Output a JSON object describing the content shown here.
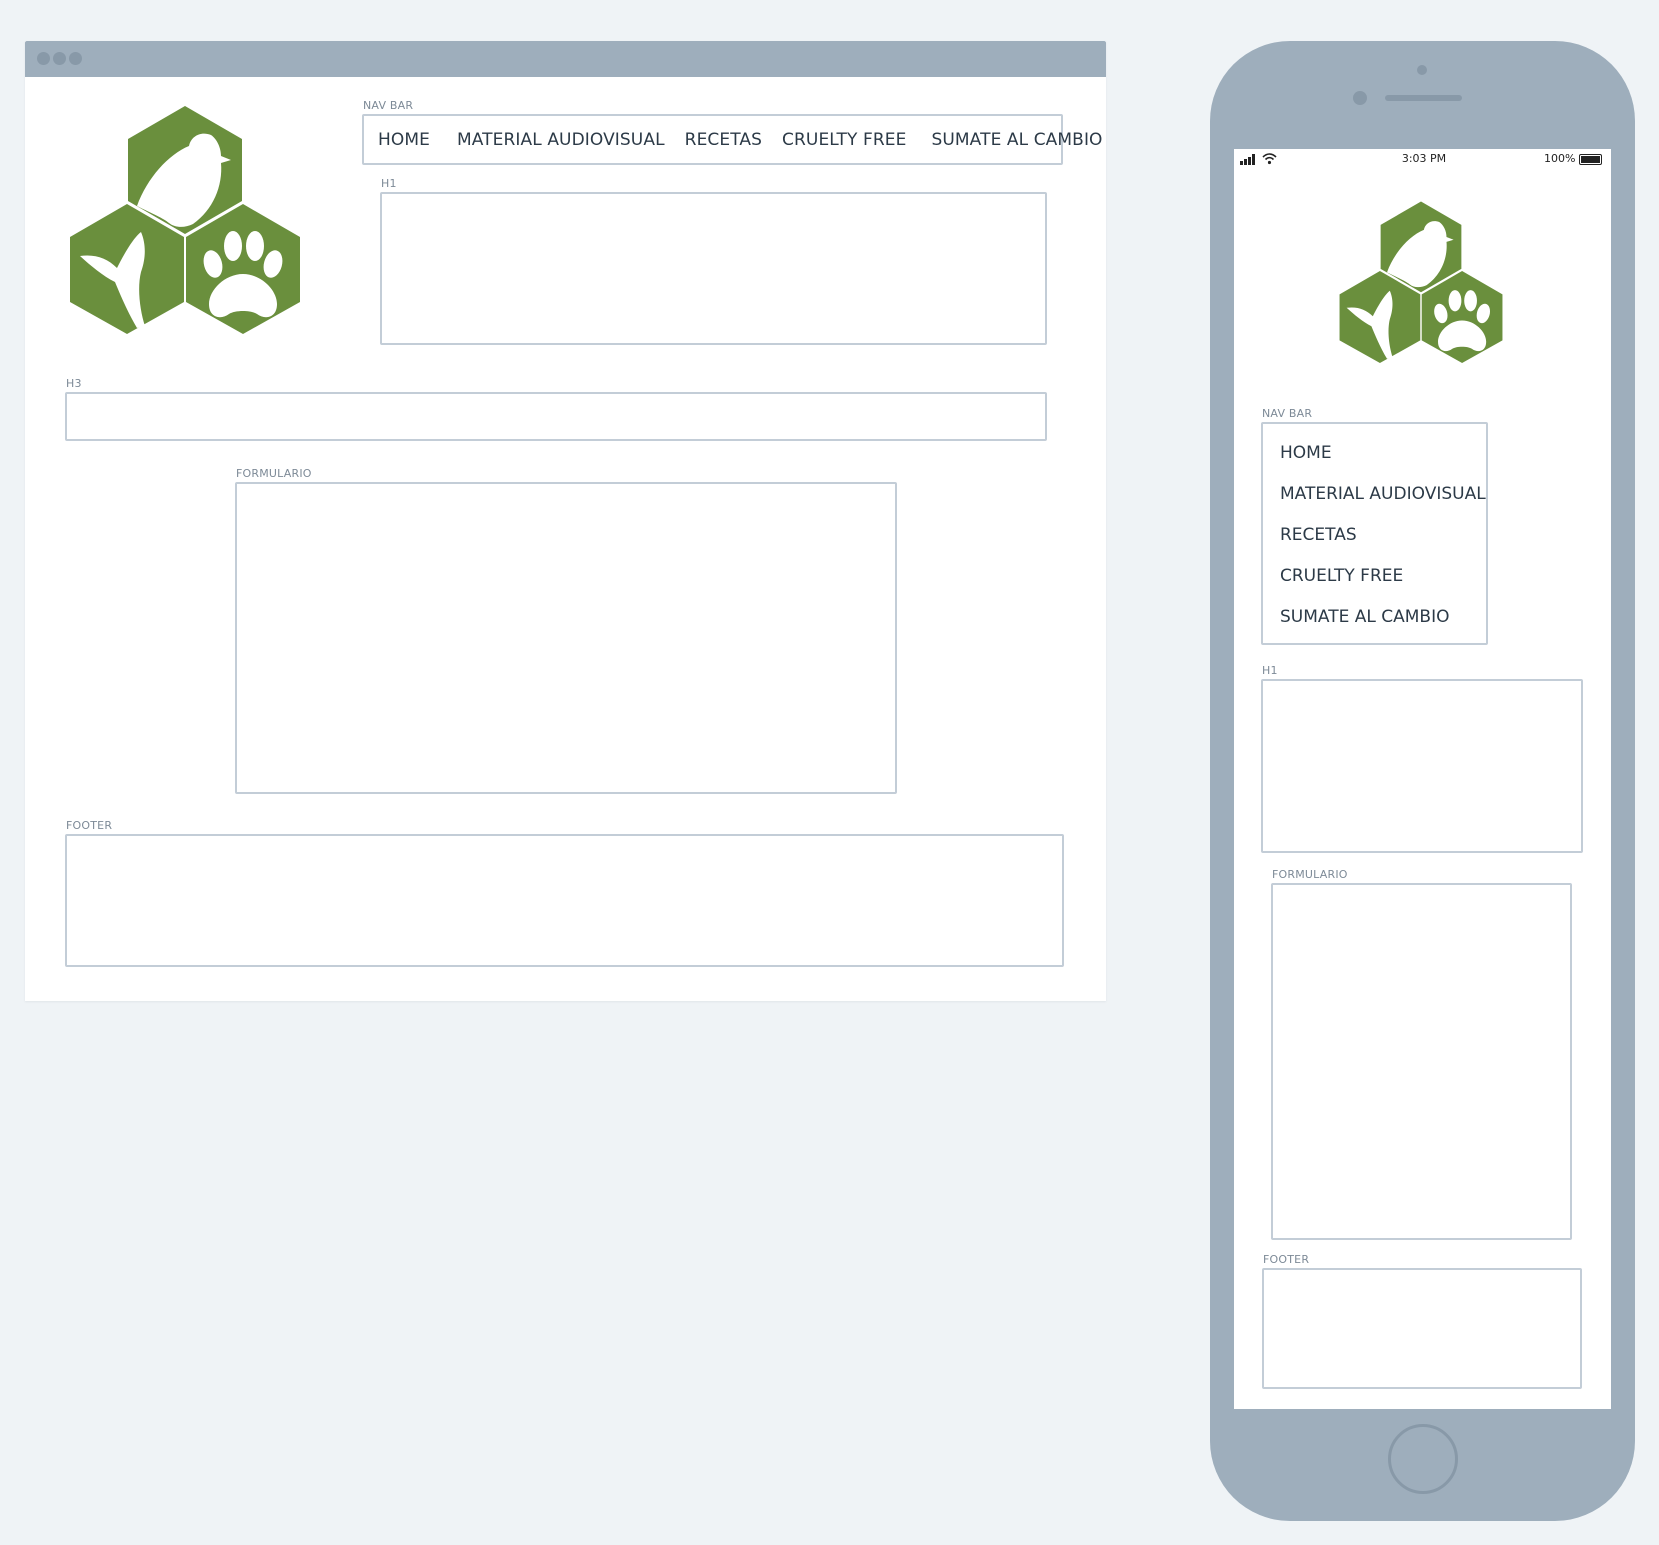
{
  "desktop": {
    "labels": {
      "nav": "NAV BAR",
      "h1": "H1",
      "h3": "H3",
      "form": "FORMULARIO",
      "footer": "FOOTER"
    },
    "nav_items": [
      "HOME",
      "MATERIAL AUDIOVISUAL",
      "RECETAS",
      "CRUELTY FREE",
      "SUMATE AL CAMBIO"
    ]
  },
  "mobile": {
    "status": {
      "time": "3:03 PM",
      "battery": "100%"
    },
    "labels": {
      "nav": "NAV BAR",
      "h1": "H1",
      "form": "FORMULARIO",
      "footer": "FOOTER"
    },
    "nav_items": [
      "HOME",
      "MATERIAL AUDIOVISUAL",
      "RECETAS",
      "CRUELTY FREE",
      "SUMATE AL CAMBIO"
    ]
  },
  "colors": {
    "logo_green": "#6a8f3d",
    "frame": "#9eaebc",
    "border": "#c3cdd7",
    "background": "#eff3f6"
  },
  "icons": [
    "logo-hexagon-animals-icon",
    "bird-icon",
    "whale-tail-icon",
    "paw-icon",
    "signal-icon",
    "wifi-icon",
    "battery-icon"
  ]
}
